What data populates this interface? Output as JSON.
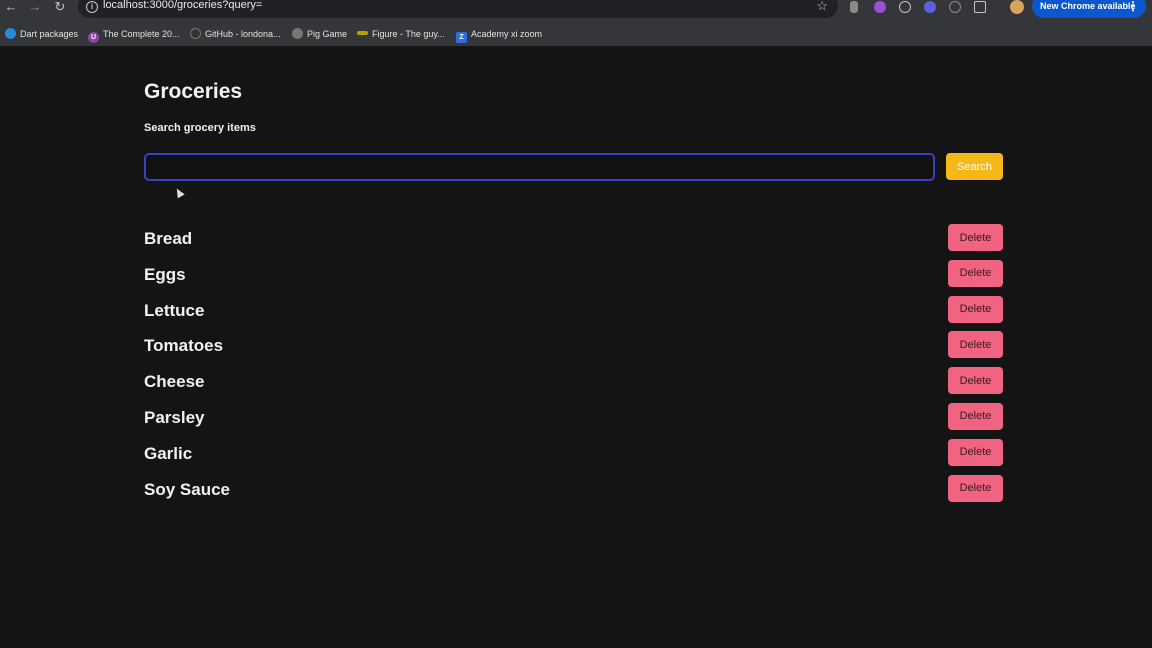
{
  "browser": {
    "url": "localhost:3000/groceries?query=",
    "new_chrome_label": "New Chrome available",
    "bookmarks": [
      {
        "label": "Dart packages",
        "color": "#2a8ad8",
        "icon": "dart-icon"
      },
      {
        "label": "The Complete 20...",
        "color": "#8e44ad",
        "icon": "udemy-icon"
      },
      {
        "label": "GitHub - londona...",
        "color": "#333333",
        "icon": "github-icon"
      },
      {
        "label": "Pig Game",
        "color": "#777777",
        "icon": "globe-icon"
      },
      {
        "label": "Figure - The guy...",
        "color": "#b8a200",
        "icon": "figure-icon"
      },
      {
        "label": "Academy xi zoom",
        "color": "#2d6ee8",
        "icon": "zoom-icon"
      }
    ]
  },
  "page": {
    "title": "Groceries",
    "search_label": "Search grocery items",
    "search_value": "",
    "search_button": "Search",
    "delete_label": "Delete",
    "items": [
      "Bread",
      "Eggs",
      "Lettuce",
      "Tomatoes",
      "Cheese",
      "Parsley",
      "Garlic",
      "Soy Sauce"
    ]
  },
  "colors": {
    "background": "#141414",
    "search_button": "#f6b818",
    "delete_button": "#f06381",
    "input_border": "#3b3fc7"
  }
}
